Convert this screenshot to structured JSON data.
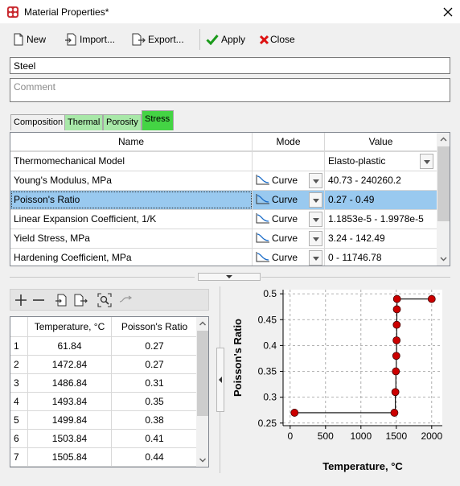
{
  "window": {
    "title": "Material Properties*"
  },
  "toolbar": {
    "new": "New",
    "import": "Import...",
    "export": "Export...",
    "apply": "Apply",
    "close": "Close"
  },
  "material": {
    "name": "Steel",
    "comment_placeholder": "Comment"
  },
  "tabs": [
    {
      "label": "Composition",
      "style": "plain"
    },
    {
      "label": "Thermal",
      "style": "green"
    },
    {
      "label": "Porosity",
      "style": "green"
    },
    {
      "label": "Stress",
      "style": "active"
    }
  ],
  "properties": {
    "headers": {
      "name": "Name",
      "mode": "Mode",
      "value": "Value"
    },
    "rows": [
      {
        "name": "Thermomechanical Model",
        "mode": "",
        "value": "Elasto-plastic"
      },
      {
        "name": "Young's Modulus, MPa",
        "mode": "Curve",
        "value": "40.73 - 240260.2"
      },
      {
        "name": "Poisson's Ratio",
        "mode": "Curve",
        "value": "0.27 - 0.49"
      },
      {
        "name": "Linear Expansion Coefficient, 1/K",
        "mode": "Curve",
        "value": "1.1853e-5 - 1.9978e-5"
      },
      {
        "name": "Yield Stress, MPa",
        "mode": "Curve",
        "value": "3.24 - 142.49"
      },
      {
        "name": "Hardening Coefficient, MPa",
        "mode": "Curve",
        "value": "0 - 11746.78"
      }
    ],
    "selected_index": 2
  },
  "curve_table": {
    "headers": {
      "temp": "Temperature, °C",
      "ratio": "Poisson's Ratio"
    },
    "rows": [
      {
        "idx": "1",
        "temp": "61.84",
        "ratio": "0.27"
      },
      {
        "idx": "2",
        "temp": "1472.84",
        "ratio": "0.27"
      },
      {
        "idx": "3",
        "temp": "1486.84",
        "ratio": "0.31"
      },
      {
        "idx": "4",
        "temp": "1493.84",
        "ratio": "0.35"
      },
      {
        "idx": "5",
        "temp": "1499.84",
        "ratio": "0.38"
      },
      {
        "idx": "6",
        "temp": "1503.84",
        "ratio": "0.41"
      },
      {
        "idx": "7",
        "temp": "1505.84",
        "ratio": "0.44"
      }
    ]
  },
  "chart_data": {
    "type": "line",
    "xlabel": "Temperature, °C",
    "ylabel": "Poisson's Ratio",
    "xlim": [
      -100,
      2150
    ],
    "ylim": [
      0.245,
      0.508
    ],
    "xticks": [
      0,
      500,
      1000,
      1500,
      2000
    ],
    "yticks": [
      0.25,
      0.3,
      0.35,
      0.4,
      0.45,
      0.5
    ],
    "grid": true,
    "step_interpolation": true,
    "points": [
      [
        61.84,
        0.27
      ],
      [
        1472.84,
        0.27
      ],
      [
        1486.84,
        0.31
      ],
      [
        1493.84,
        0.35
      ],
      [
        1499.84,
        0.38
      ],
      [
        1503.84,
        0.41
      ],
      [
        1505.84,
        0.44
      ],
      [
        1508,
        0.47
      ],
      [
        1510,
        0.49
      ],
      [
        2000,
        0.49
      ]
    ],
    "marker_color": "#cc0000",
    "line_color": "#000000"
  }
}
